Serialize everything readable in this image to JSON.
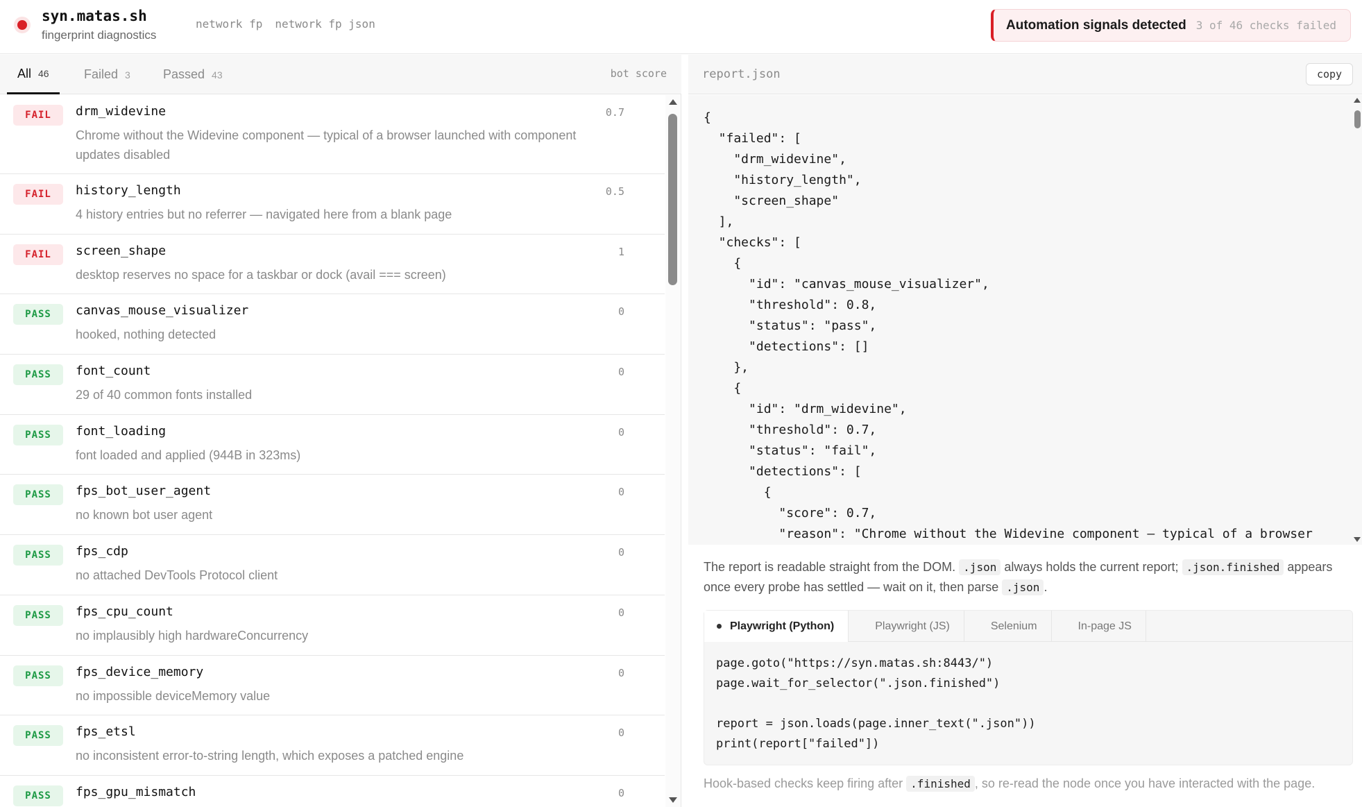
{
  "header": {
    "title": "syn.matas.sh",
    "subtitle": "fingerprint diagnostics",
    "nav": [
      "network fp",
      "network fp json"
    ],
    "alert_title": "Automation signals detected",
    "alert_detail": "3 of 46 checks failed"
  },
  "tabs": {
    "all_label": "All",
    "all_count": "46",
    "failed_label": "Failed",
    "failed_count": "3",
    "passed_label": "Passed",
    "passed_count": "43",
    "score_header": "bot score"
  },
  "checks": [
    {
      "status": "FAIL",
      "name": "drm_widevine",
      "desc": "Chrome without the Widevine component — typical of a browser launched with component updates disabled",
      "score": "0.7"
    },
    {
      "status": "FAIL",
      "name": "history_length",
      "desc": "4 history entries but no referrer — navigated here from a blank page",
      "score": "0.5"
    },
    {
      "status": "FAIL",
      "name": "screen_shape",
      "desc": "desktop reserves no space for a taskbar or dock (avail === screen)",
      "score": "1"
    },
    {
      "status": "PASS",
      "name": "canvas_mouse_visualizer",
      "desc": "hooked, nothing detected",
      "score": "0"
    },
    {
      "status": "PASS",
      "name": "font_count",
      "desc": "29 of 40 common fonts installed",
      "score": "0"
    },
    {
      "status": "PASS",
      "name": "font_loading",
      "desc": "font loaded and applied (944B in 323ms)",
      "score": "0"
    },
    {
      "status": "PASS",
      "name": "fps_bot_user_agent",
      "desc": "no known bot user agent",
      "score": "0"
    },
    {
      "status": "PASS",
      "name": "fps_cdp",
      "desc": "no attached DevTools Protocol client",
      "score": "0"
    },
    {
      "status": "PASS",
      "name": "fps_cpu_count",
      "desc": "no implausibly high hardwareConcurrency",
      "score": "0"
    },
    {
      "status": "PASS",
      "name": "fps_device_memory",
      "desc": "no impossible deviceMemory value",
      "score": "0"
    },
    {
      "status": "PASS",
      "name": "fps_etsl",
      "desc": "no inconsistent error-to-string length, which exposes a patched engine",
      "score": "0"
    },
    {
      "status": "PASS",
      "name": "fps_gpu_mismatch",
      "desc": "",
      "score": "0"
    }
  ],
  "report": {
    "filename": "report.json",
    "copy_label": "copy",
    "json_text": "{\n  \"failed\": [\n    \"drm_widevine\",\n    \"history_length\",\n    \"screen_shape\"\n  ],\n  \"checks\": [\n    {\n      \"id\": \"canvas_mouse_visualizer\",\n      \"threshold\": 0.8,\n      \"status\": \"pass\",\n      \"detections\": []\n    },\n    {\n      \"id\": \"drm_widevine\",\n      \"threshold\": 0.7,\n      \"status\": \"fail\",\n      \"detections\": [\n        {\n          \"score\": 0.7,\n          \"reason\": \"Chrome without the Widevine component — typical of a browser"
  },
  "info": {
    "t1": "The report is readable straight from the DOM.",
    "c1": ".json",
    "t2": "always holds the current report;",
    "c2": ".json.finished",
    "t3": "appears once every probe has settled — wait on it, then parse",
    "c3": ".json",
    "t4": "."
  },
  "code": {
    "tabs": [
      "Playwright (Python)",
      "Playwright (JS)",
      "Selenium",
      "In-page JS"
    ],
    "snippet": "page.goto(\"https://syn.matas.sh:8443/\")\npage.wait_for_selector(\".json.finished\")\n\nreport = json.loads(page.inner_text(\".json\"))\nprint(report[\"failed\"])"
  },
  "footnote": {
    "t1": "Hook-based checks keep firing after",
    "c1": ".finished",
    "t2": ", so re-read the node once you have interacted with the page."
  },
  "colors": {
    "fail": "#d5222c",
    "pass": "#1e9a45",
    "accent_red": "#d91f26"
  }
}
